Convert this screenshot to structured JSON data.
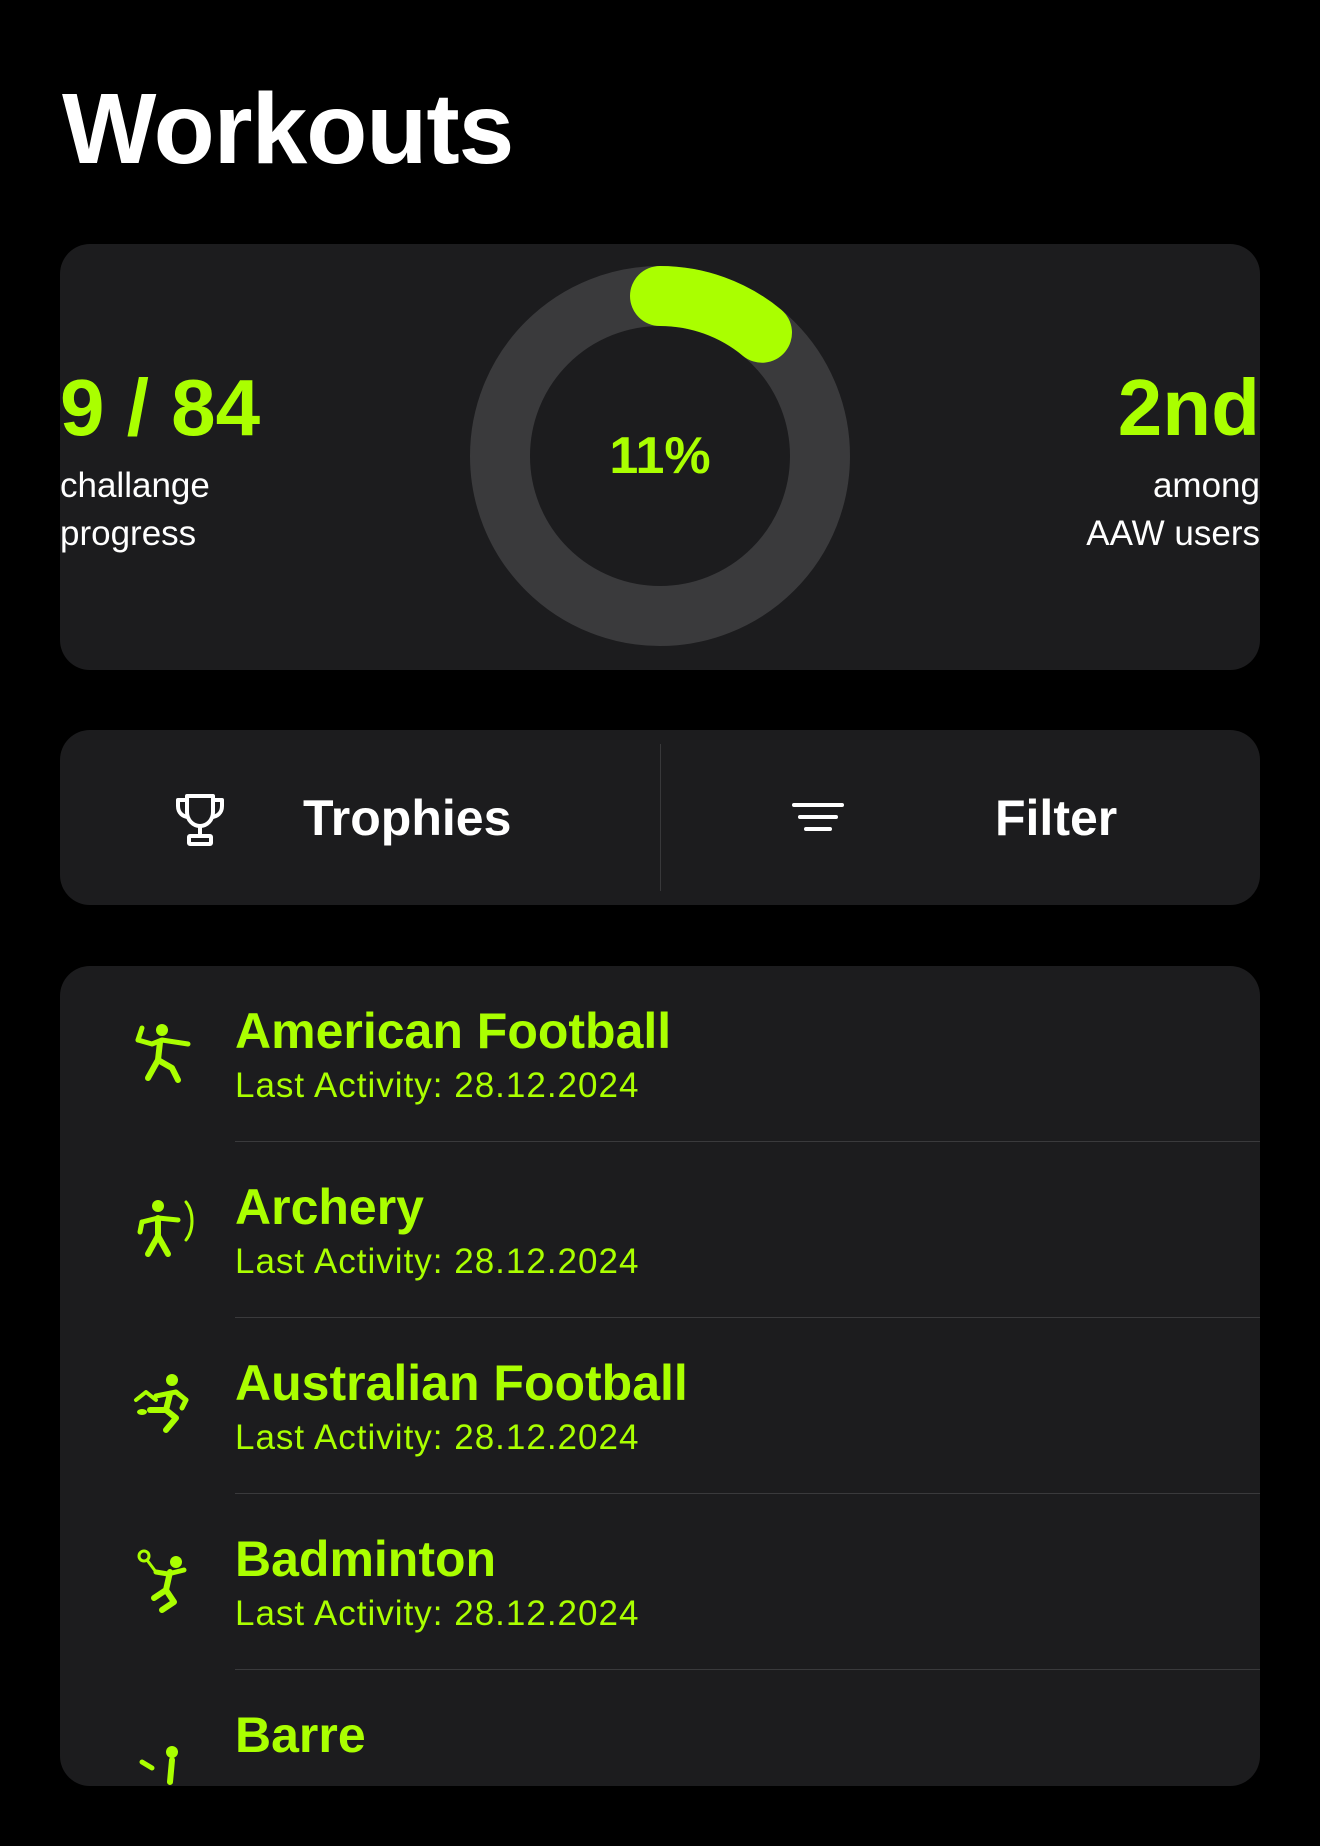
{
  "header": {
    "title": "Workouts"
  },
  "progress": {
    "count_value": "9 / 84",
    "count_caption_line1": "challange",
    "count_caption_line2": "progress",
    "percent_label": "11%",
    "percent_fraction": 0.11,
    "rank_value": "2nd",
    "rank_caption_line1": "among",
    "rank_caption_line2": "AAW users"
  },
  "actions": {
    "trophies_label": "Trophies",
    "filter_label": "Filter",
    "trophies_icon": "trophy-icon",
    "filter_icon": "filter-lines-icon"
  },
  "workouts": [
    {
      "title": "American Football",
      "subtitle": "Last Activity: 28.12.2024",
      "icon": "american-football-icon"
    },
    {
      "title": "Archery",
      "subtitle": "Last Activity: 28.12.2024",
      "icon": "archery-icon"
    },
    {
      "title": "Australian Football",
      "subtitle": "Last Activity: 28.12.2024",
      "icon": "australian-football-icon"
    },
    {
      "title": "Badminton",
      "subtitle": "Last Activity: 28.12.2024",
      "icon": "badminton-icon"
    },
    {
      "title": "Barre",
      "subtitle": "",
      "icon": "barre-icon"
    }
  ],
  "colors": {
    "accent": "#aaff00",
    "background": "#000000",
    "card": "#1c1c1e",
    "ring_track": "#3a3a3c"
  }
}
